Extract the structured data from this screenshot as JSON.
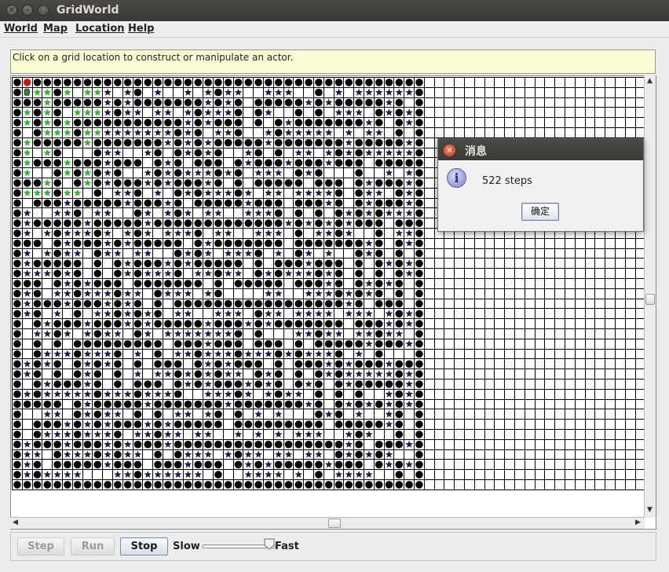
{
  "window": {
    "title": "GridWorld"
  },
  "menu": {
    "items": [
      "World",
      "Map",
      "Location",
      "Help"
    ]
  },
  "message": {
    "text": "Click on a grid location to construct or manipulate an actor."
  },
  "controls": {
    "step_label": "Step",
    "run_label": "Run",
    "stop_label": "Stop",
    "slow_label": "Slow",
    "fast_label": "Fast",
    "speed_fraction": 0.92
  },
  "dialog": {
    "title": "消息",
    "message": "522 steps",
    "ok_label": "确定"
  },
  "grid": {
    "columns": 63,
    "rows": 41,
    "maze_columns": 41,
    "maze_rows": 41,
    "colors": {
      "gridline": "#000000",
      "rock": "#000000",
      "trail": "#1a1f4a",
      "explorer": "#2db82d",
      "start": "#cc1111"
    }
  },
  "colors": {
    "titlebar": "#3f3e3a",
    "message_bg": "#fbfbd4",
    "dialog_bg": "#f1f1f1"
  }
}
